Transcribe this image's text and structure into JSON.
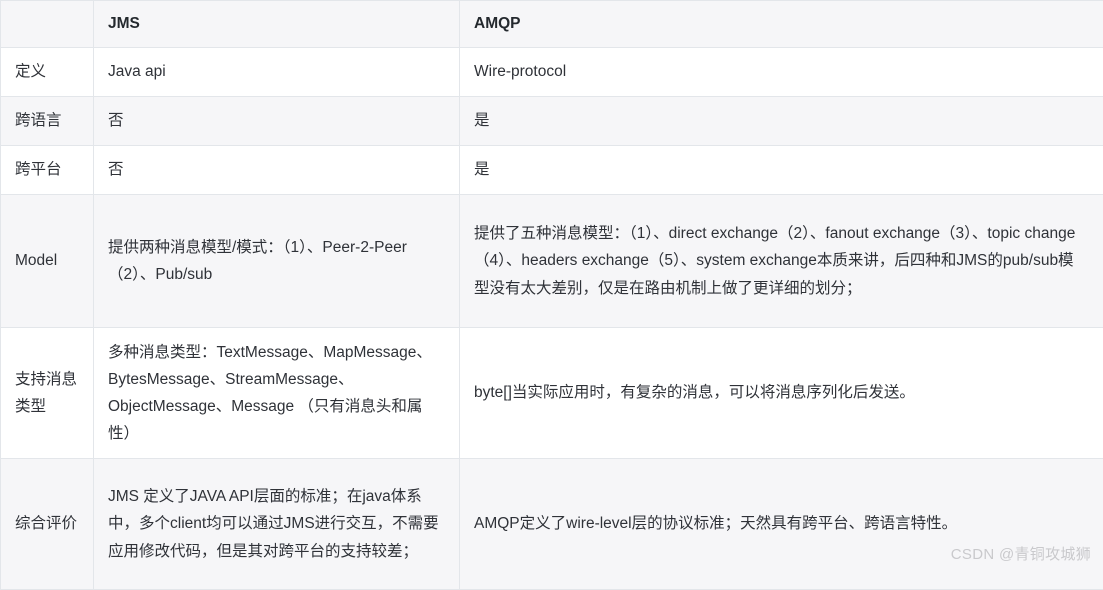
{
  "table": {
    "headers": [
      "",
      "JMS",
      "AMQP"
    ],
    "rows": [
      {
        "attr": "定义",
        "jms": "Java api",
        "amqp": "Wire-protocol"
      },
      {
        "attr": "跨语言",
        "jms": "否",
        "amqp": "是"
      },
      {
        "attr": "跨平台",
        "jms": "否",
        "amqp": "是"
      },
      {
        "attr": "Model",
        "jms": "提供两种消息模型/模式：（1）、Peer-2-Peer（2）、Pub/sub",
        "amqp": "提供了五种消息模型：（1）、direct exchange（2）、fanout exchange（3）、topic change（4）、headers exchange（5）、system exchange本质来讲，后四种和JMS的pub/sub模型没有太大差别，仅是在路由机制上做了更详细的划分；"
      },
      {
        "attr": "支持消息类型",
        "jms": "多种消息类型：TextMessage、MapMessage、BytesMessage、StreamMessage、ObjectMessage、Message （只有消息头和属性）",
        "amqp": "byte[]当实际应用时，有复杂的消息，可以将消息序列化后发送。"
      },
      {
        "attr": "综合评价",
        "jms": "JMS 定义了JAVA API层面的标准；在java体系中，多个client均可以通过JMS进行交互，不需要应用修改代码，但是其对跨平台的支持较差；",
        "amqp": "AMQP定义了wire-level层的协议标准；天然具有跨平台、跨语言特性。"
      }
    ]
  },
  "watermark": {
    "text": "CSDN @青铜攻城狮"
  },
  "colors": {
    "header_bg": "#f6f6f8",
    "stripe_bg": "#f6f6f8",
    "row_bg": "#ffffff",
    "border": "#e3e6ea",
    "text": "#2f3238",
    "header_text": "#24292e",
    "watermark_text": "#c9c9cc"
  }
}
